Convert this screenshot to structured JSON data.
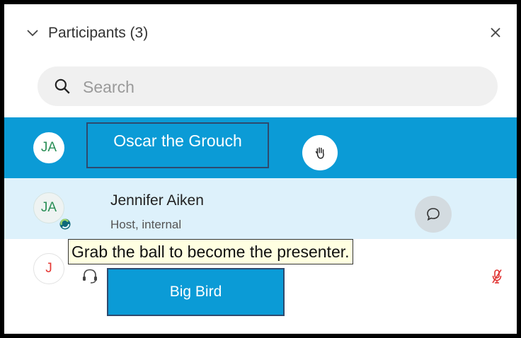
{
  "header": {
    "title": "Participants (3)",
    "collapse_icon": "chevron-down-icon",
    "close_icon": "close-icon"
  },
  "search": {
    "placeholder": "Search",
    "value": ""
  },
  "participants": [
    {
      "initials": "JA",
      "name": "Oscar the Grouch",
      "selected": true,
      "action_icon": "raise-hand-icon"
    },
    {
      "initials": "JA",
      "name": "Jennifer Aiken",
      "subtitle": "Host, internal",
      "badge_icon": "presenter-ball-icon",
      "action_icon": "chat-icon"
    },
    {
      "initials": "J",
      "name": "Big Bird",
      "status_icon": "headset-icon",
      "mic_icon": "mic-muted-icon"
    }
  ],
  "tooltip": "Grab the ball to become the presenter.",
  "colors": {
    "selected_row": "#0b9bd6",
    "hover_row": "#ddf1fb",
    "avatar_green": "#2b8f57",
    "avatar_red": "#e53935",
    "tooltip_bg": "#ffffe1"
  }
}
